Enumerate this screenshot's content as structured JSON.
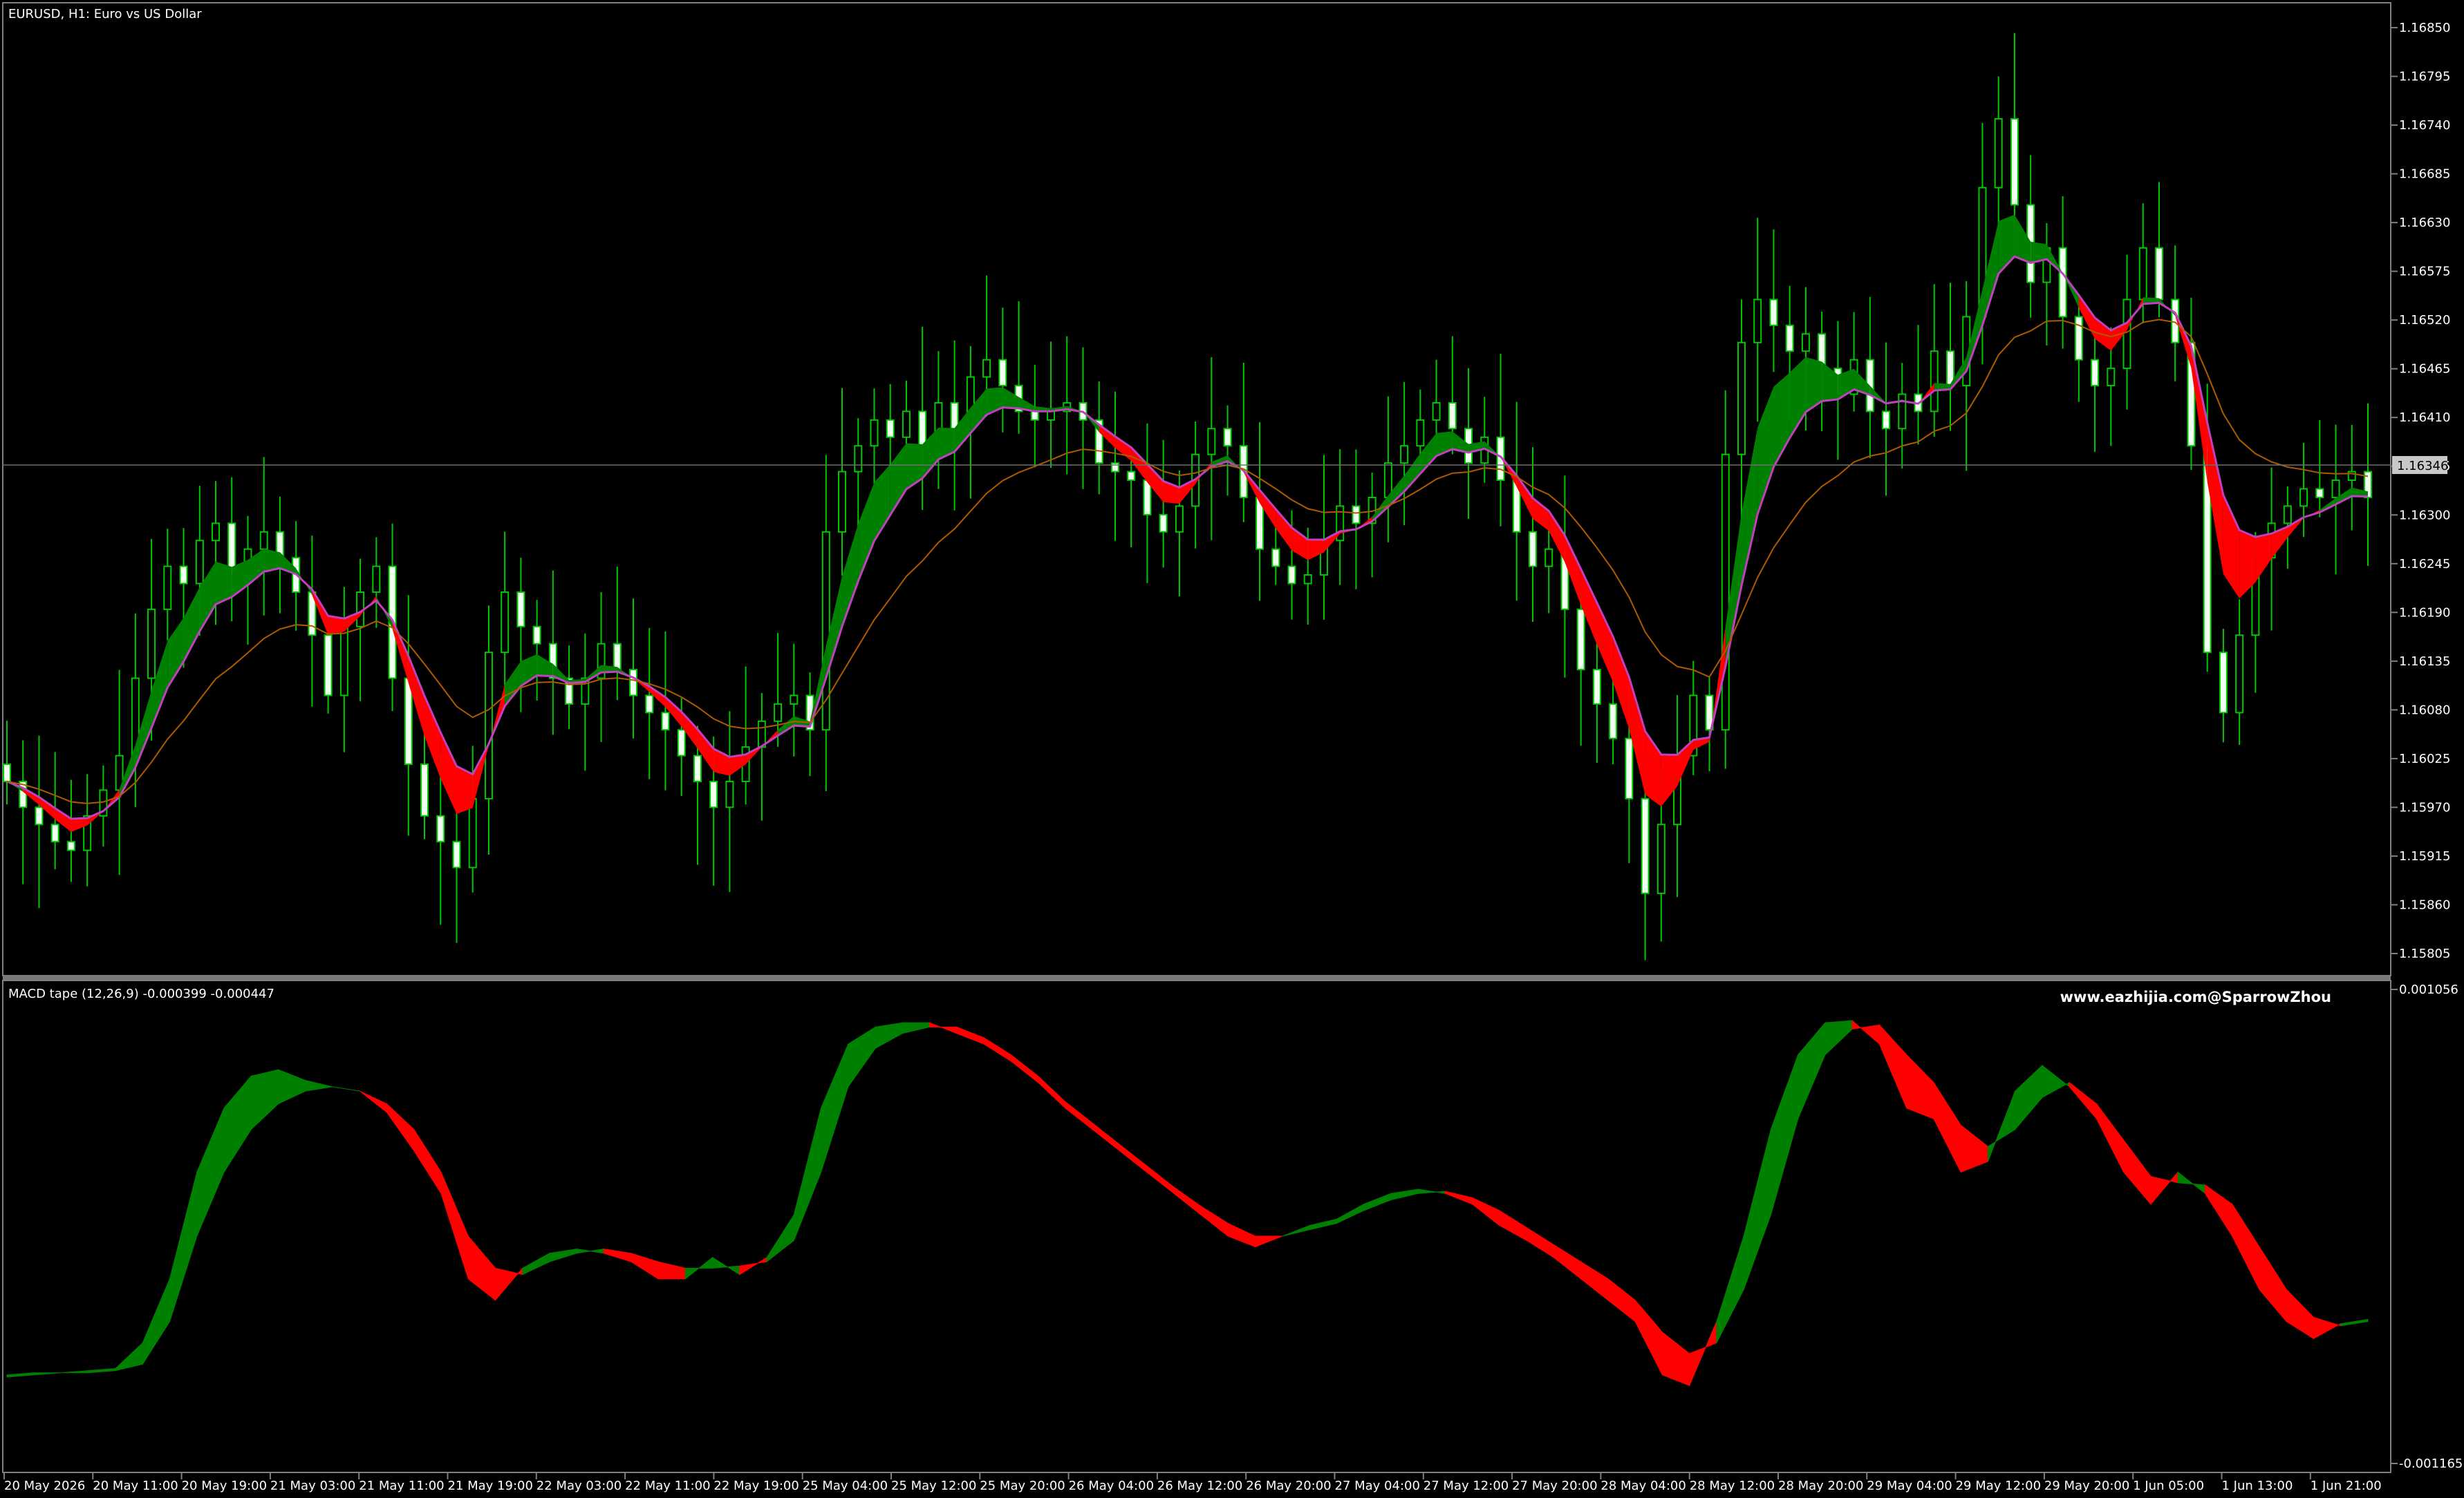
{
  "chart_title": "EURUSD, H1:  Euro vs US Dollar",
  "indicator_label": "MACD tape (12,26,9) -0.000399 -0.000447",
  "watermark": "www.eazhijia.com@SparrowZhou",
  "current_price": "1.16346",
  "colors": {
    "background": "#000000",
    "candle": "#00c800",
    "candle_up_body": "#000000",
    "candle_down_body": "#f0fff0",
    "tape_up": "#008000",
    "tape_down": "#ff0000",
    "ma_slow": "#b05a00",
    "ma_line": "#c040c0",
    "grid": "#808080"
  },
  "price_axis": [
    "1.16850",
    "1.16795",
    "1.16740",
    "1.16685",
    "1.16630",
    "1.16575",
    "1.16520",
    "1.16465",
    "1.16410",
    "1.16355",
    "1.16300",
    "1.16245",
    "1.16190",
    "1.16135",
    "1.16080",
    "1.16025",
    "1.15970",
    "1.15915",
    "1.15860",
    "1.15805"
  ],
  "macd_axis": [
    "0.001056",
    "-0.001165"
  ],
  "time_axis": [
    "20 May 2026",
    "20 May 11:00",
    "20 May 19:00",
    "21 May 03:00",
    "21 May 11:00",
    "21 May 19:00",
    "22 May 03:00",
    "22 May 11:00",
    "22 May 19:00",
    "25 May 04:00",
    "25 May 12:00",
    "25 May 20:00",
    "26 May 04:00",
    "26 May 12:00",
    "26 May 20:00",
    "27 May 04:00",
    "27 May 12:00",
    "27 May 20:00",
    "28 May 04:00",
    "28 May 12:00",
    "28 May 20:00",
    "29 May 04:00",
    "29 May 12:00",
    "29 May 20:00",
    "1 Jun 05:00",
    "1 Jun 13:00",
    "1 Jun 21:00"
  ],
  "chart_data": {
    "type": "candlestick",
    "symbol": "EURUSD",
    "timeframe": "H1",
    "ylim": [
      1.1578,
      1.169
    ],
    "current_price": 1.16346,
    "macd_ylim": [
      -0.001165,
      0.001056
    ],
    "closes": [
      1.16,
      1.1597,
      1.1595,
      1.1593,
      1.1592,
      1.1596,
      1.1599,
      1.1603,
      1.1612,
      1.162,
      1.1625,
      1.1623,
      1.1628,
      1.163,
      1.1624,
      1.1627,
      1.1629,
      1.1626,
      1.1622,
      1.1617,
      1.161,
      1.1618,
      1.1622,
      1.1625,
      1.1612,
      1.1602,
      1.1596,
      1.1593,
      1.159,
      1.1598,
      1.1615,
      1.1622,
      1.1618,
      1.1616,
      1.1612,
      1.1609,
      1.1612,
      1.1616,
      1.1613,
      1.161,
      1.1608,
      1.1606,
      1.1603,
      1.16,
      1.1597,
      1.16,
      1.1604,
      1.1607,
      1.1609,
      1.161,
      1.1606,
      1.1629,
      1.1636,
      1.1639,
      1.1642,
      1.164,
      1.1643,
      1.1639,
      1.1644,
      1.1641,
      1.1647,
      1.1649,
      1.1646,
      1.1643,
      1.1642,
      1.1643,
      1.1644,
      1.1642,
      1.1637,
      1.1636,
      1.1635,
      1.1631,
      1.1629,
      1.1632,
      1.1638,
      1.1641,
      1.1639,
      1.1633,
      1.1627,
      1.1625,
      1.1623,
      1.1624,
      1.1628,
      1.1632,
      1.163,
      1.1633,
      1.1637,
      1.1639,
      1.1642,
      1.1644,
      1.1641,
      1.1637,
      1.164,
      1.1635,
      1.1629,
      1.1625,
      1.1627,
      1.162,
      1.1613,
      1.1609,
      1.1605,
      1.1598,
      1.1587,
      1.1595,
      1.1603,
      1.161,
      1.1606,
      1.1638,
      1.1651,
      1.1656,
      1.1653,
      1.165,
      1.1652,
      1.1648,
      1.1645,
      1.1649,
      1.1643,
      1.1641,
      1.1645,
      1.1643,
      1.165,
      1.1646,
      1.1654,
      1.1669,
      1.1677,
      1.1667,
      1.1658,
      1.1662,
      1.1654,
      1.1649,
      1.1646,
      1.1648,
      1.1656,
      1.1662,
      1.1656,
      1.1651,
      1.1639,
      1.1615,
      1.1608,
      1.1617,
      1.1626,
      1.163,
      1.1632,
      1.1634,
      1.1633,
      1.1635,
      1.1636,
      1.1633
    ],
    "macd_tape_fast": [
      -0.00075,
      -0.00074,
      -0.00074,
      -0.00073,
      -0.00072,
      -0.0006,
      -0.0003,
      0.0002,
      0.0005,
      0.00065,
      0.00068,
      0.00063,
      0.0006,
      0.00058,
      0.00048,
      0.0003,
      0.0001,
      -0.0003,
      -0.0004,
      -0.00025,
      -0.00018,
      -0.00016,
      -0.00018,
      -0.00022,
      -0.0003,
      -0.0003,
      -0.0002,
      -0.00028,
      -0.0002,
      0.0,
      0.0005,
      0.0008,
      0.00088,
      0.0009,
      0.0009,
      0.00085,
      0.0008,
      0.00072,
      0.00062,
      0.0005,
      0.0004,
      0.0003,
      0.0002,
      0.0001,
      0.0,
      -0.0001,
      -0.00015,
      -0.0001,
      -5e-05,
      -2e-05,
      5e-05,
      0.0001,
      0.00012,
      0.0001,
      5e-05,
      -5e-05,
      -0.00012,
      -0.0002,
      -0.0003,
      -0.0004,
      -0.0005,
      -0.00075,
      -0.0008,
      -0.0005,
      -0.0001,
      0.0004,
      0.00075,
      0.0009,
      0.00091,
      0.0008,
      0.0005,
      0.00045,
      0.0002,
      0.00025,
      0.00058,
      0.0007,
      0.0006,
      0.00045,
      0.0002,
      5e-05,
      0.0002,
      0.0001,
      -0.0001,
      -0.00035,
      -0.0005,
      -0.00058,
      -0.00051,
      -0.00049
    ],
    "macd_tape_slow": [
      -0.00076,
      -0.00075,
      -0.00074,
      -0.00074,
      -0.00073,
      -0.0007,
      -0.0005,
      -0.0001,
      0.0002,
      0.0004,
      0.00052,
      0.00058,
      0.0006,
      0.00058,
      0.00052,
      0.0004,
      0.0002,
      -0.0001,
      -0.00025,
      -0.00028,
      -0.00022,
      -0.00018,
      -0.00016,
      -0.00018,
      -0.00022,
      -0.00025,
      -0.00025,
      -0.00024,
      -0.00022,
      -0.00012,
      0.0002,
      0.0006,
      0.00078,
      0.00085,
      0.00088,
      0.00088,
      0.00083,
      0.00075,
      0.00065,
      0.00053,
      0.00043,
      0.00033,
      0.00023,
      0.00013,
      4e-05,
      -4e-05,
      -0.0001,
      -0.0001,
      -7e-05,
      -4e-05,
      2e-05,
      7e-05,
      0.0001,
      0.00011,
      8e-05,
      2e-05,
      -6e-05,
      -0.00014,
      -0.00022,
      -0.0003,
      -0.0004,
      -0.00055,
      -0.00065,
      -0.0006,
      -0.00035,
      0.0,
      0.00045,
      0.00075,
      0.00087,
      0.00089,
      0.00075,
      0.00062,
      0.00042,
      0.00032,
      0.0004,
      0.00055,
      0.00062,
      0.00052,
      0.00035,
      0.00018,
      0.00015,
      0.00014,
      5e-05,
      -0.00015,
      -0.00035,
      -0.00048,
      -0.00052,
      -0.0005
    ]
  }
}
